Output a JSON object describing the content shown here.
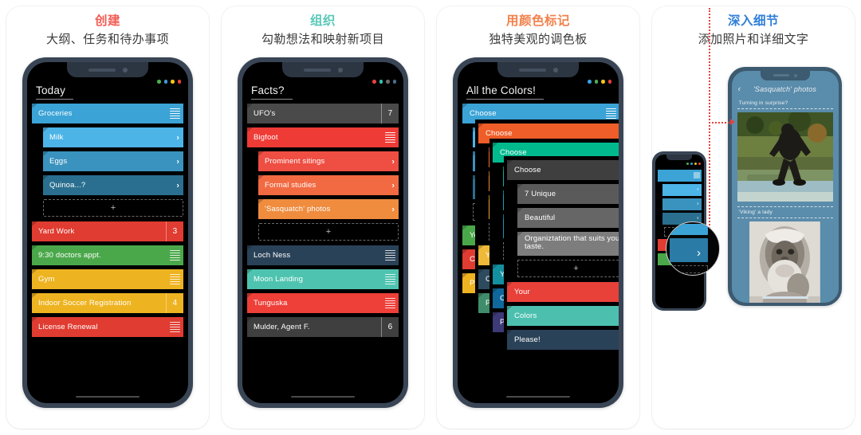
{
  "panels": [
    {
      "title": "创建",
      "title_color": "#f25c54",
      "subtitle": "大纲、任务和待办事项",
      "doc_title": "Today",
      "dots": [
        "#4caf50",
        "#3b9ddd",
        "#f0c419",
        "#e8413a"
      ],
      "rows": [
        {
          "label": "Groceries",
          "color": "#3ba3d6",
          "accessory": "lines",
          "indent": 0
        },
        {
          "label": "Milk",
          "color": "#4cb4e7",
          "accessory": "chevron",
          "indent": 1
        },
        {
          "label": "Eggs",
          "color": "#3a92be",
          "accessory": "chevron",
          "indent": 1
        },
        {
          "label": "Quinoa...?",
          "color": "#2a6f8f",
          "accessory": "chevron",
          "indent": 1
        },
        {
          "label": "+",
          "type": "add",
          "indent": 1
        },
        {
          "label": "Yard Work",
          "color": "#e03c31",
          "accessory": "badge",
          "badge": "3",
          "indent": 0
        },
        {
          "label": "9:30 doctors appt.",
          "color": "#4aa84a",
          "accessory": "lines",
          "indent": 0
        },
        {
          "label": "Gym",
          "color": "#eeb320",
          "accessory": "lines",
          "indent": 0
        },
        {
          "label": "Indoor Soccer Registration",
          "color": "#eeb320",
          "accessory": "badge",
          "badge": "4",
          "indent": 0
        },
        {
          "label": "License Renewal",
          "color": "#e03c31",
          "accessory": "lines",
          "indent": 0
        }
      ]
    },
    {
      "title": "组织",
      "title_color": "#58c8b8",
      "subtitle": "勾勒想法和映射新项目",
      "doc_title": "Facts?",
      "dots": [
        "#e8413a",
        "#33c4b0",
        "#6b6b6b",
        "#4a6d8c"
      ],
      "rows": [
        {
          "label": "UFO's",
          "color": "#4a4a4a",
          "accessory": "badge",
          "badge": "7",
          "indent": 0
        },
        {
          "label": "Bigfoot",
          "color": "#ef3b36",
          "accessory": "lines",
          "indent": 0
        },
        {
          "label": "Prominent sitings",
          "color": "#ef4e43",
          "accessory": "chevron",
          "indent": 1
        },
        {
          "label": "Formal studies",
          "color": "#f26a42",
          "accessory": "chevron",
          "indent": 1
        },
        {
          "label": "'Sasquatch' photos",
          "color": "#f08c3e",
          "accessory": "chevron",
          "indent": 1
        },
        {
          "label": "+",
          "type": "add",
          "indent": 1
        },
        {
          "label": "Loch Ness",
          "color": "#2a4258",
          "accessory": "solidlines",
          "indent": 0
        },
        {
          "label": "Moon Landing",
          "color": "#4ec4b0",
          "accessory": "lines",
          "indent": 0
        },
        {
          "label": "Tunguska",
          "color": "#ee3f38",
          "accessory": "solidlines",
          "indent": 0
        },
        {
          "label": "Mulder, Agent F.",
          "color": "#3f3f3f",
          "accessory": "badge",
          "badge": "6",
          "indent": 0
        }
      ]
    },
    {
      "title": "用颜色标记",
      "title_color": "#f2804a",
      "subtitle": "独特美观的调色板",
      "doc_title": "All the Colors!",
      "dots": [
        "#3b9ddd",
        "#4caf50",
        "#f0c419",
        "#e8413a"
      ],
      "layers": [
        {
          "header": {
            "label": "Choose",
            "color": "#3ba3d6"
          },
          "children": [
            {
              "label": "7 Unique",
              "color": "#4cb4e7"
            },
            {
              "label": "Beautiful",
              "color": "#3a92be"
            },
            {
              "label": "Organization that suits your taste.",
              "color": "#2a6f8f"
            }
          ],
          "footer": [
            {
              "label": "Your",
              "color": "#4aa84a"
            },
            {
              "label": "Colors",
              "color": "#e03c31"
            },
            {
              "label": "Please!",
              "color": "#eeb320"
            }
          ]
        },
        {
          "header": {
            "label": "Choose",
            "color": "#ef5d28"
          },
          "children": [
            {
              "label": "7 Unique",
              "color": "#f07030"
            },
            {
              "label": "Beautiful",
              "color": "#ef8a33"
            },
            {
              "label": "Organization that suits your taste.",
              "color": "#f0a62f"
            }
          ],
          "footer": [
            {
              "label": "Your",
              "color": "#eeb938"
            },
            {
              "label": "Colors",
              "color": "#2e4a5e"
            },
            {
              "label": "Please!",
              "color": "#3f8d6b"
            }
          ]
        },
        {
          "header": {
            "label": "Choose",
            "color": "#00ba8e"
          },
          "children": [
            {
              "label": "7 Unique",
              "color": "#11ab9b"
            },
            {
              "label": "Beautiful",
              "color": "#1b9ab0"
            },
            {
              "label": "Organization that suits your taste.",
              "color": "#1b93ad"
            }
          ],
          "footer": [
            {
              "label": "Your",
              "color": "#148fa0"
            },
            {
              "label": "Colors",
              "color": "#10679c"
            },
            {
              "label": "Please!",
              "color": "#3d3a78"
            }
          ]
        },
        {
          "header": {
            "label": "Choose",
            "color": "#3f3f3f"
          },
          "children": [
            {
              "label": "7 Unique",
              "color": "#5a5a5a"
            },
            {
              "label": "Beautiful",
              "color": "#666666"
            },
            {
              "label": "Organiztation that suits your taste.",
              "color": "#7d7d7d"
            }
          ],
          "footer": [
            {
              "label": "Your",
              "color": "#e8413a"
            },
            {
              "label": "Colors",
              "color": "#4cbfae"
            },
            {
              "label": "Please!",
              "color": "#2a4258"
            }
          ]
        }
      ],
      "add_label": "+"
    },
    {
      "title": "深入细节",
      "title_color": "#2f7fd8",
      "subtitle": "添加照片和详细文字",
      "dots": [
        "#4caf50",
        "#3b9ddd",
        "#f0c419",
        "#e8413a"
      ],
      "mini_rows": [
        {
          "color": "#3ba3d6",
          "accessory": "lines"
        },
        {
          "color": "#4cb4e7",
          "accessory": "chevron"
        },
        {
          "color": "#3a92be",
          "accessory": "chevron"
        },
        {
          "color": "#2a6f8f",
          "accessory": "chevron"
        },
        {
          "type": "add"
        },
        {
          "color": "#e03c31",
          "accessory": "badge",
          "badge": "3"
        },
        {
          "color": "#4aa84a",
          "accessory": "lines"
        }
      ],
      "photo_phone": {
        "back_icon": "chevron-left",
        "nav_title": "'Sasquatch' photos",
        "entries": [
          {
            "caption": "Turning in surprise?",
            "photo": "bigfoot-color-walking"
          },
          {
            "caption": "'Viking' a lady",
            "photo": "sasquatch-bw-portrait"
          }
        ]
      }
    }
  ]
}
